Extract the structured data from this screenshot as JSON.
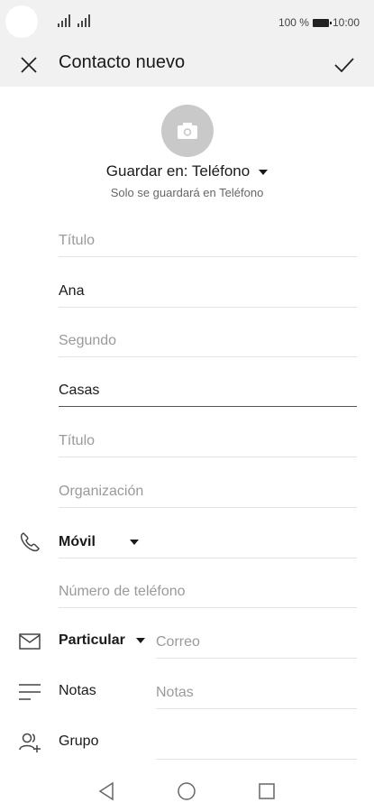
{
  "status": {
    "battery_text": "100 %",
    "time": "10:00"
  },
  "appbar": {
    "title": "Contacto nuevo"
  },
  "save": {
    "label": "Guardar en: Teléfono",
    "subtitle": "Solo se guardará en Teléfono"
  },
  "fields": {
    "prefix_placeholder": "Título",
    "first_name": "Ana",
    "middle_placeholder": "Segundo",
    "last_name": "Casas",
    "suffix_placeholder": "Título",
    "organization_placeholder": "Organización"
  },
  "phone": {
    "type": "Móvil",
    "number_placeholder": "Número de teléfono"
  },
  "email": {
    "type": "Particular",
    "placeholder": "Correo"
  },
  "notes": {
    "label": "Notas",
    "placeholder": "Notas"
  },
  "group": {
    "label": "Grupo"
  },
  "icons": [
    "close-icon",
    "check-icon",
    "camera-icon",
    "phone-icon",
    "mail-icon",
    "notes-icon",
    "group-icon",
    "nav-back-icon",
    "nav-home-icon",
    "nav-recents-icon"
  ]
}
